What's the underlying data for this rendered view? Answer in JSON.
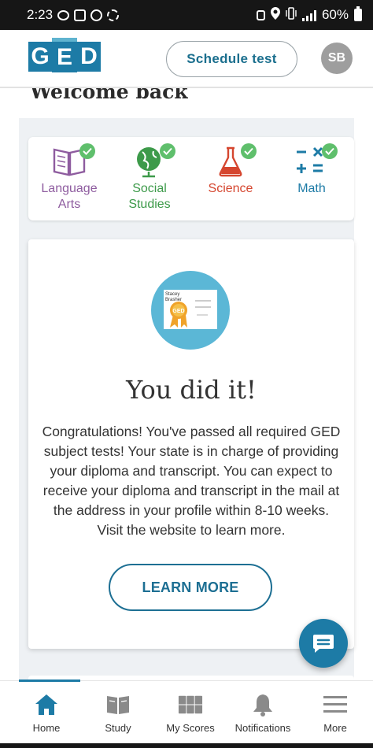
{
  "status_bar": {
    "time": "2:23",
    "battery": "60%"
  },
  "header": {
    "logo_letters": [
      "G",
      "E",
      "D"
    ],
    "schedule_label": "Schedule test",
    "avatar_initials": "SB"
  },
  "welcome": "Welcome back",
  "subjects": [
    {
      "label": "Language Arts",
      "color": "#8e5c9f",
      "icon": "book-icon",
      "completed": true
    },
    {
      "label": "Social Studies",
      "color": "#3d9a4a",
      "icon": "globe-icon",
      "completed": true
    },
    {
      "label": "Science",
      "color": "#d5462f",
      "icon": "flask-icon",
      "completed": true
    },
    {
      "label": "Math",
      "color": "#1d7ba6",
      "icon": "math-symbols-icon",
      "completed": true
    }
  ],
  "certificate": {
    "name": "Stacey Brasher",
    "seal_text": "GED"
  },
  "completion": {
    "title": "You did it!",
    "message": "Congratulations! You've passed all required GED subject tests! Your state is in charge of providing your diploma and transcript. You can expect to receive your diploma and transcript in the mail at the address in your profile within 8-10 weeks. Visit the website to learn more.",
    "button_label": "LEARN MORE"
  },
  "bottom_nav": [
    {
      "label": "Home",
      "icon": "home-icon",
      "active": true
    },
    {
      "label": "Study",
      "icon": "study-book-icon",
      "active": false
    },
    {
      "label": "My Scores",
      "icon": "scores-icon",
      "active": false
    },
    {
      "label": "Notifications",
      "icon": "bell-icon",
      "active": false
    },
    {
      "label": "More",
      "icon": "menu-icon",
      "active": false
    }
  ],
  "colors": {
    "brand": "#1d7ba6",
    "accent_light": "#5bb7d6",
    "check_green": "#5fbf6c"
  }
}
